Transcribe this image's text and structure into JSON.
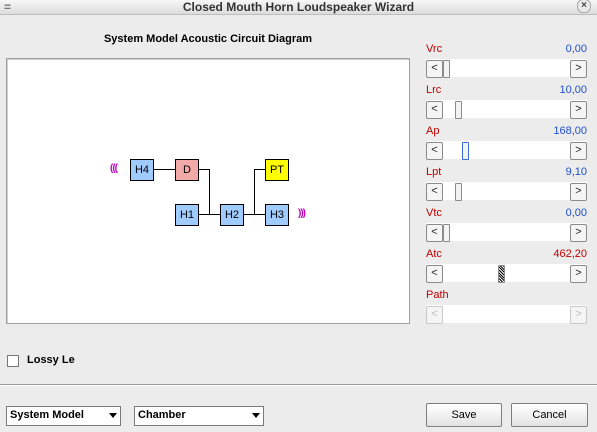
{
  "window": {
    "title": "Closed Mouth Horn Loudspeaker Wizard",
    "close_icon": "close-icon"
  },
  "diagram": {
    "title": "System Model Acoustic Circuit Diagram",
    "blocks": {
      "h4": "H4",
      "d": "D",
      "pt": "PT",
      "h1": "H1",
      "h2": "H2",
      "h3": "H3"
    },
    "waves_left": "(((",
    "waves_right": ")))",
    "colors": {
      "horn": "#9fcbff",
      "driver": "#f4a9a9",
      "port": "#ffff00",
      "waves": "#c000c0"
    }
  },
  "params": [
    {
      "name": "Vrc",
      "value": "0,00",
      "label_color": "red",
      "value_color": "blue",
      "level": 0.0
    },
    {
      "name": "Lrc",
      "value": "10,00",
      "label_color": "red",
      "value_color": "blue",
      "level": 0.09
    },
    {
      "name": "Ap",
      "value": "168,00",
      "label_color": "red",
      "value_color": "blue",
      "level": 0.15
    },
    {
      "name": "Lpt",
      "value": "9,10",
      "label_color": "red",
      "value_color": "blue",
      "level": 0.09
    },
    {
      "name": "Vtc",
      "value": "0,00",
      "label_color": "red",
      "value_color": "blue",
      "level": 0.0
    },
    {
      "name": "Atc",
      "value": "462,20",
      "label_color": "red",
      "value_color": "red",
      "level": 0.42
    },
    {
      "name": "Path",
      "value": "",
      "label_color": "red",
      "value_color": "blue",
      "level": null
    }
  ],
  "scroll_arrows": {
    "left": "<",
    "right": ">"
  },
  "options": {
    "lossy_le_label": "Lossy Le",
    "lossy_le_checked": false
  },
  "footer": {
    "model_select": "System Model",
    "chamber_select": "Chamber",
    "save_label": "Save",
    "cancel_label": "Cancel"
  }
}
